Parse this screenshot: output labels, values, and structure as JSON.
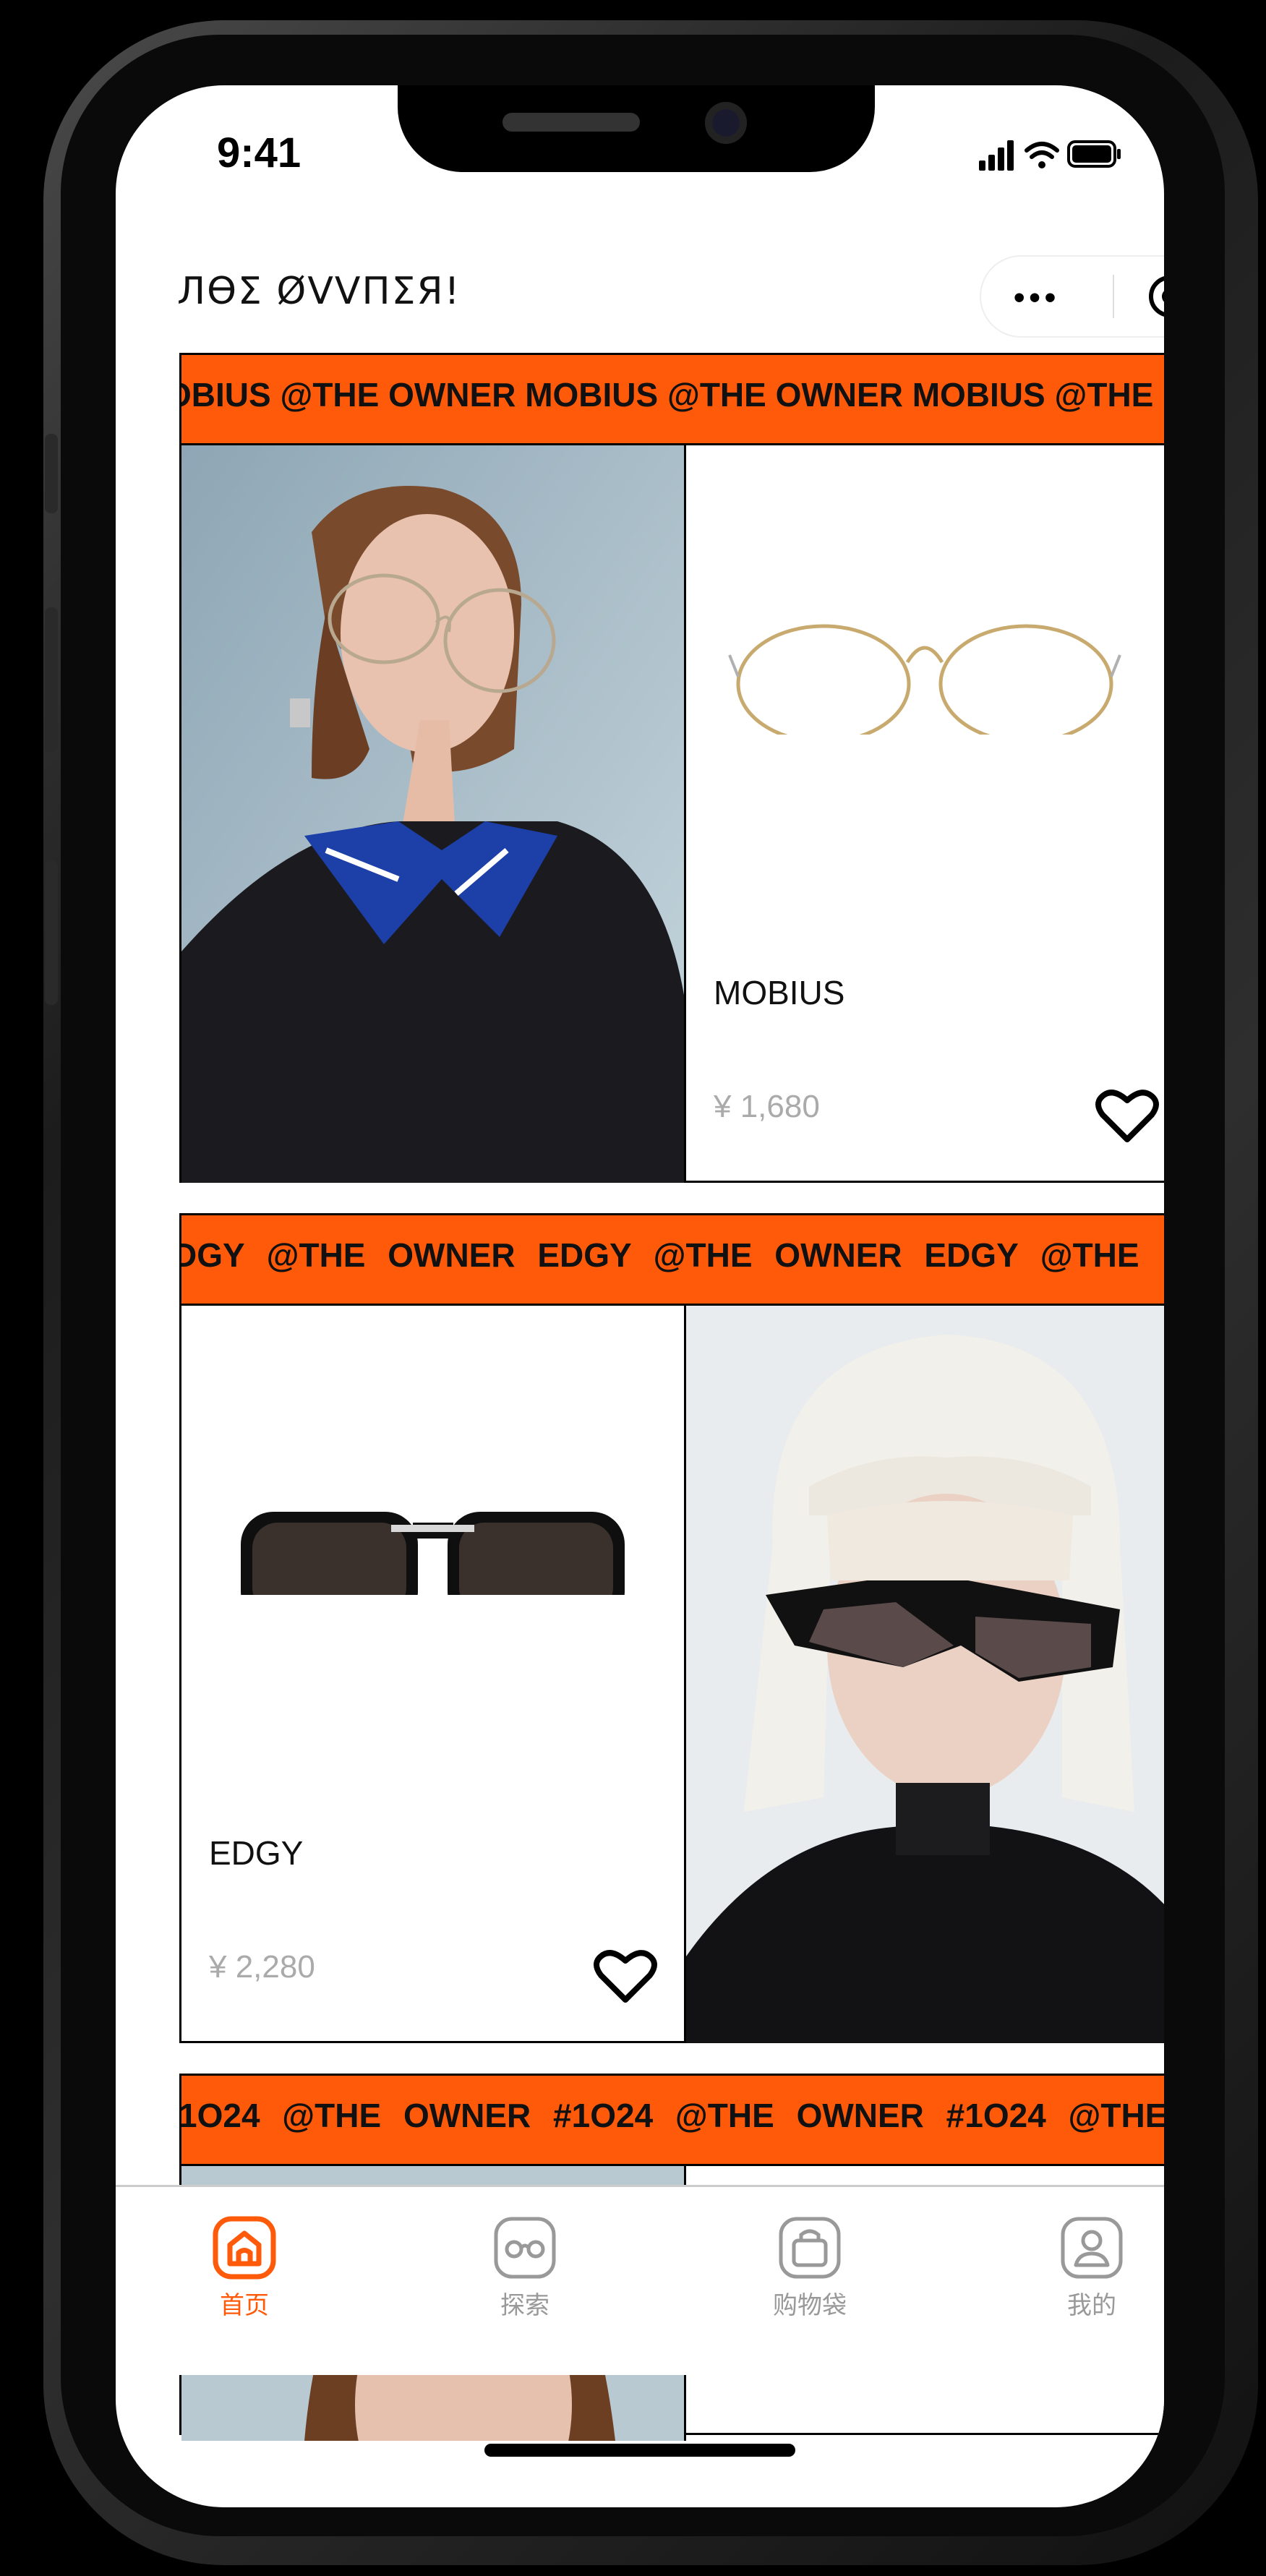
{
  "status_bar": {
    "time": "9:41"
  },
  "nav": {
    "brand": "ЛӨΣ ØVVПΣЯ!"
  },
  "colors": {
    "accent": "#ff5a0a",
    "banner_text": "#111111",
    "price": "#aaaaaa"
  },
  "cards": [
    {
      "banner": "OBIUS @THE OWNER MOBIUS @THE OWNER MOBIUS @THE",
      "name": "MOBIUS",
      "price": "¥ 1,680"
    },
    {
      "banner": "DGY @THE OWNER EDGY @THE OWNER EDGY @THE",
      "name": "EDGY",
      "price": "¥ 2,280"
    },
    {
      "banner": "1O24 @THE OWNER #1O24 @THE OWNER #1O24 @THE"
    }
  ],
  "tabbar": {
    "tabs": [
      {
        "label": "首页",
        "icon": "home-icon",
        "active": true
      },
      {
        "label": "探索",
        "icon": "glasses-icon",
        "active": false
      },
      {
        "label": "购物袋",
        "icon": "shopping-bag-icon",
        "active": false
      },
      {
        "label": "我的",
        "icon": "user-icon",
        "active": false
      }
    ]
  }
}
